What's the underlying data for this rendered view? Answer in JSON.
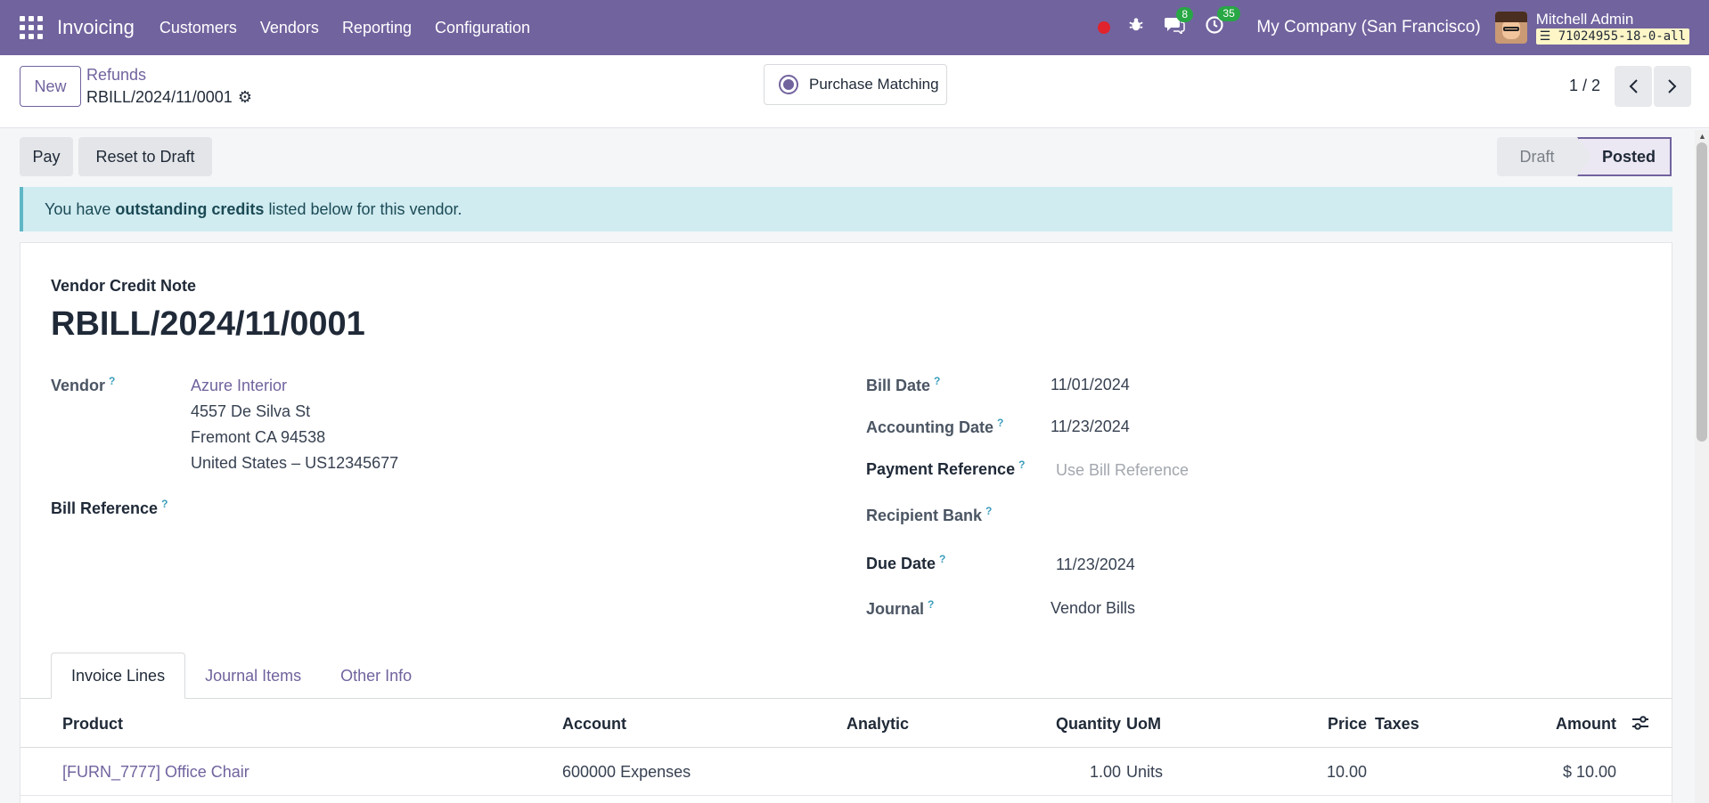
{
  "navbar": {
    "app_name": "Invoicing",
    "menu": [
      "Customers",
      "Vendors",
      "Reporting",
      "Configuration"
    ],
    "messages_count": "8",
    "activities_count": "35",
    "company": "My Company (San Francisco)",
    "user_name": "Mitchell Admin",
    "database": "71024955-18-0-all",
    "accent_color": "#71639e"
  },
  "control_panel": {
    "new_label": "New",
    "breadcrumb_parent": "Refunds",
    "breadcrumb_current": "RBILL/2024/11/0001",
    "smart_button_label": "Purchase Matching",
    "pager": "1 / 2"
  },
  "actions": {
    "pay_label": "Pay",
    "reset_label": "Reset to Draft"
  },
  "statusbar": {
    "stages": [
      "Draft",
      "Posted"
    ],
    "current": "Posted"
  },
  "alert": {
    "prefix": "You have",
    "emphasis": "outstanding credits",
    "suffix": "listed below for this vendor."
  },
  "form": {
    "doc_type": "Vendor Credit Note",
    "doc_name": "RBILL/2024/11/0001",
    "help_marker": "?",
    "vendor_label": "Vendor",
    "vendor_name": "Azure Interior",
    "vendor_address": [
      "4557 De Silva St",
      "Fremont CA 94538",
      "United States – US12345677"
    ],
    "bill_reference_label": "Bill Reference",
    "bill_date_label": "Bill Date",
    "bill_date": "11/01/2024",
    "accounting_date_label": "Accounting Date",
    "accounting_date": "11/23/2024",
    "payment_reference_label": "Payment Reference",
    "payment_reference_placeholder": "Use Bill Reference",
    "recipient_bank_label": "Recipient Bank",
    "due_date_label": "Due Date",
    "due_date": "11/23/2024",
    "journal_label": "Journal",
    "journal": "Vendor Bills"
  },
  "tabs": [
    "Invoice Lines",
    "Journal Items",
    "Other Info"
  ],
  "invoice_lines": {
    "columns": [
      "Product",
      "Account",
      "Analytic",
      "Quantity",
      "UoM",
      "Price",
      "Taxes",
      "Amount"
    ],
    "rows": [
      {
        "product": "[FURN_7777] Office Chair",
        "account": "600000 Expenses",
        "analytic": "",
        "quantity": "1.00",
        "uom": "Units",
        "price": "10.00",
        "taxes": "",
        "amount": "$ 10.00"
      }
    ]
  }
}
